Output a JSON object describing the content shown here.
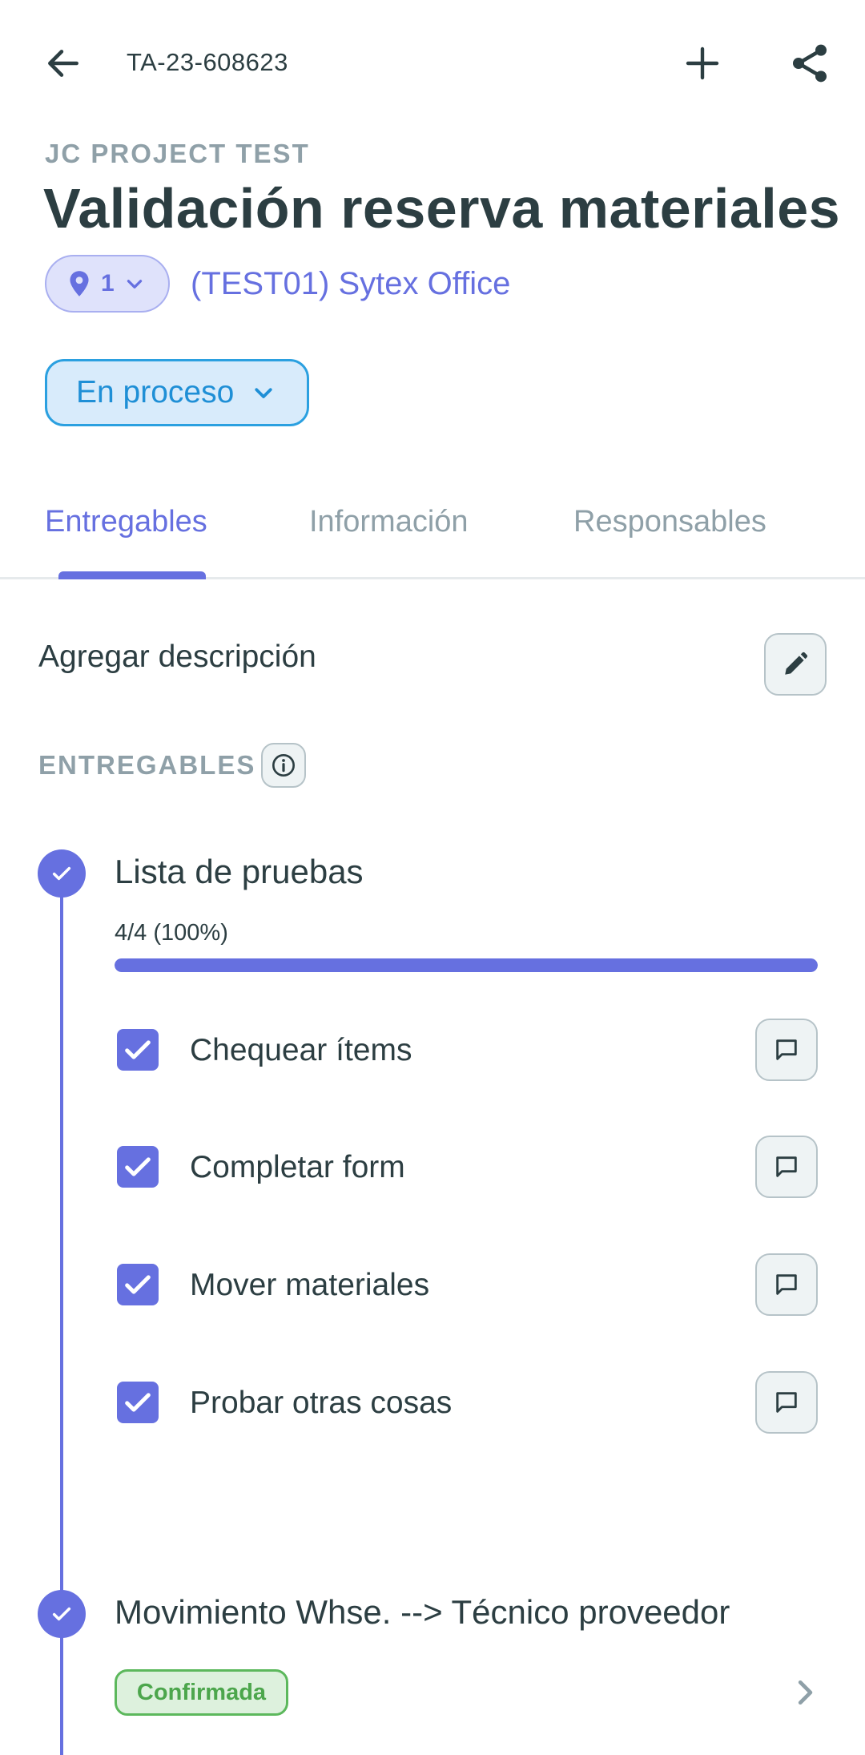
{
  "header": {
    "task_id": "TA-23-608623"
  },
  "project": {
    "name": "JC PROJECT TEST",
    "title": "Validación reserva materiales",
    "site_count": "1",
    "site_name": "(TEST01) Sytex Office"
  },
  "status": {
    "label": "En proceso"
  },
  "tabs": [
    {
      "label": "Entregables",
      "active": true
    },
    {
      "label": "Información",
      "active": false
    },
    {
      "label": "Responsables",
      "active": false
    }
  ],
  "description": {
    "placeholder": "Agregar descripción"
  },
  "deliverables_section": {
    "label": "ENTREGABLES"
  },
  "deliverables": [
    {
      "title": "Lista de pruebas",
      "progress_text": "4/4 (100%)",
      "progress_fraction": 1.0,
      "items": [
        {
          "label": "Chequear ítems",
          "checked": true
        },
        {
          "label": "Completar form",
          "checked": true
        },
        {
          "label": "Mover materiales",
          "checked": true
        },
        {
          "label": "Probar otras cosas",
          "checked": true
        }
      ]
    },
    {
      "title": "Movimiento Whse. --> Técnico proveedor",
      "badge": "Confirmada"
    }
  ],
  "colors": {
    "accent": "#6670e0",
    "status_blue": "#2ba0e0",
    "confirmed_green": "#5cb85c",
    "muted": "#8fa0a8"
  },
  "icons": {
    "back": "arrow-left-icon",
    "add": "plus-icon",
    "share": "share-icon",
    "location": "map-pin-icon",
    "edit": "pencil-icon",
    "info": "info-icon",
    "comment": "comment-icon",
    "check": "check-icon",
    "chevron_right": "chevron-right-icon"
  }
}
